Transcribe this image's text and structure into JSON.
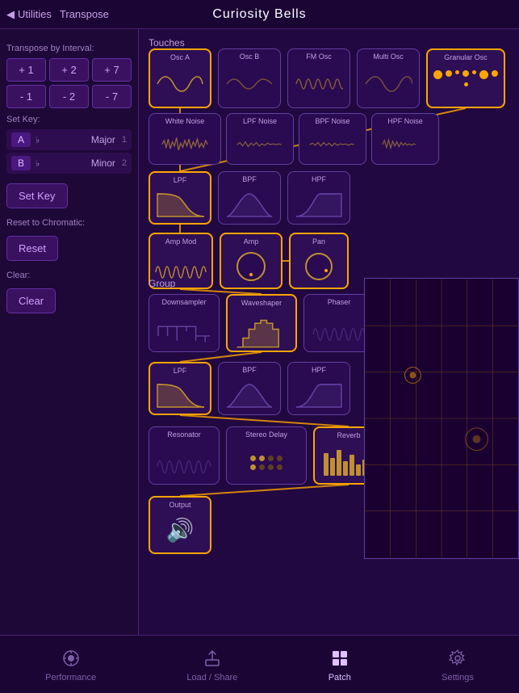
{
  "header": {
    "back_icon": "◀",
    "utilities_label": "Utilities",
    "transpose_label": "Transpose",
    "title": "Curiosity Bells"
  },
  "left_panel": {
    "transpose_section": "Transpose by Interval:",
    "interval_buttons": [
      {
        "label": "+ 1"
      },
      {
        "label": "+ 2"
      },
      {
        "label": "+ 7"
      },
      {
        "label": "- 1"
      },
      {
        "label": "- 2"
      },
      {
        "label": "- 7"
      }
    ],
    "set_key_label": "Set Key:",
    "key_rows": [
      {
        "note": "A",
        "sharp": "♭",
        "scale": "Major",
        "num": "1"
      },
      {
        "note": "B",
        "sharp": "♭",
        "scale": "Minor",
        "num": "2"
      }
    ],
    "set_key_btn": "Set Key",
    "reset_label": "Reset to Chromatic:",
    "reset_btn": "Reset",
    "clear_label": "Clear:",
    "clear_btn": "Clear"
  },
  "main": {
    "touches_label": "Touches",
    "group_label": "Group",
    "nodes": {
      "osc_a": "Osc A",
      "osc_b": "Osc B",
      "fm_osc": "FM Osc",
      "multi_osc": "Multi Osc",
      "granular_osc": "Granular Osc",
      "white_noise": "White Noise",
      "lpf_noise": "LPF Noise",
      "bpf_noise": "BPF Noise",
      "hpf_noise": "HPF Noise",
      "lpf": "LPF",
      "bpf": "BPF",
      "hpf": "HPF",
      "amp_mod": "Amp Mod",
      "amp": "Amp",
      "pan": "Pan",
      "downsampler": "Downsampler",
      "waveshaper": "Waveshaper",
      "phaser": "Phaser",
      "grp_lpf": "LPF",
      "grp_bpf": "BPF",
      "grp_hpf": "HPF",
      "resonator": "Resonator",
      "stereo_delay": "Stereo Delay",
      "reverb": "Reverb",
      "output": "Output"
    }
  },
  "bottom_nav": {
    "items": [
      {
        "label": "Performance",
        "icon": "♟",
        "active": false
      },
      {
        "label": "Load / Share",
        "icon": "⬆",
        "active": false
      },
      {
        "label": "Patch",
        "icon": "⊞",
        "active": true
      },
      {
        "label": "Settings",
        "icon": "⚙",
        "active": false
      }
    ]
  }
}
